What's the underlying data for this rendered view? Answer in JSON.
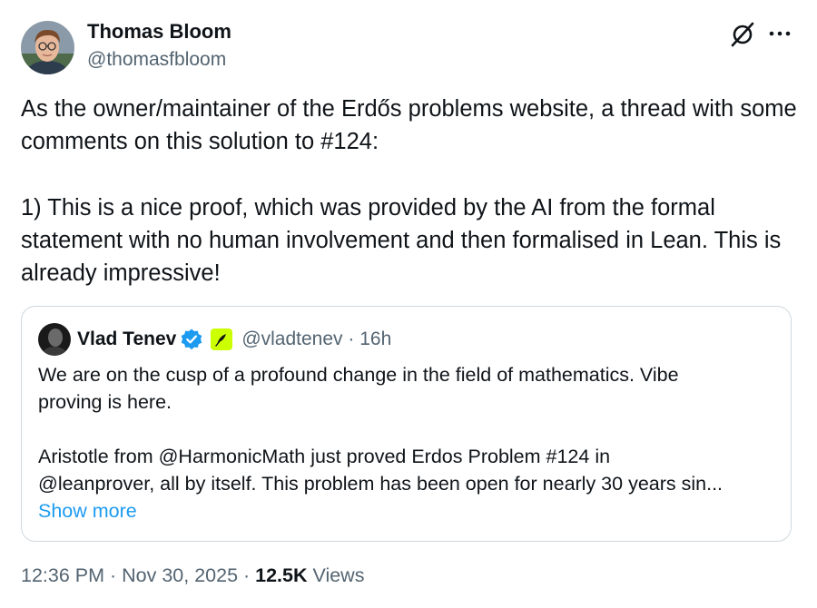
{
  "author": {
    "name": "Thomas Bloom",
    "handle": "@thomasfbloom"
  },
  "tweet": {
    "paragraphs": [
      "As the owner/maintainer of the Erdős problems website, a thread with some comments on this solution to #124:",
      "1) This is a nice proof, which was provided by the AI from the formal statement with no human involvement and then formalised in Lean. This is already impressive!"
    ]
  },
  "quote": {
    "name": "Vlad Tenev",
    "handle_time": "@vladtenev · 16h",
    "lines": [
      "We are on the cusp of a profound change in the field of mathematics. Vibe",
      "proving is here."
    ],
    "lines2": [
      "Aristotle from @HarmonicMath just proved Erdos Problem #124 in",
      "@leanprover, all by itself. This problem has been open for nearly 30 years sin..."
    ],
    "show_more": "Show more"
  },
  "meta": {
    "timestamp": "12:36 PM · Nov 30, 2025 · ",
    "views_count": "12.5K",
    "views_label": " Views"
  },
  "icons": {
    "grok": "grok-icon",
    "more": "more-horizontal-icon",
    "verified": "verified-badge-icon",
    "affiliate": "robinhood-feather-icon"
  },
  "colors": {
    "text": "#0f1419",
    "secondary": "#536471",
    "link": "#1d9bf0",
    "verified": "#1d9bf0",
    "border": "#cfd9de",
    "affiliate_bg": "#ccff00"
  }
}
